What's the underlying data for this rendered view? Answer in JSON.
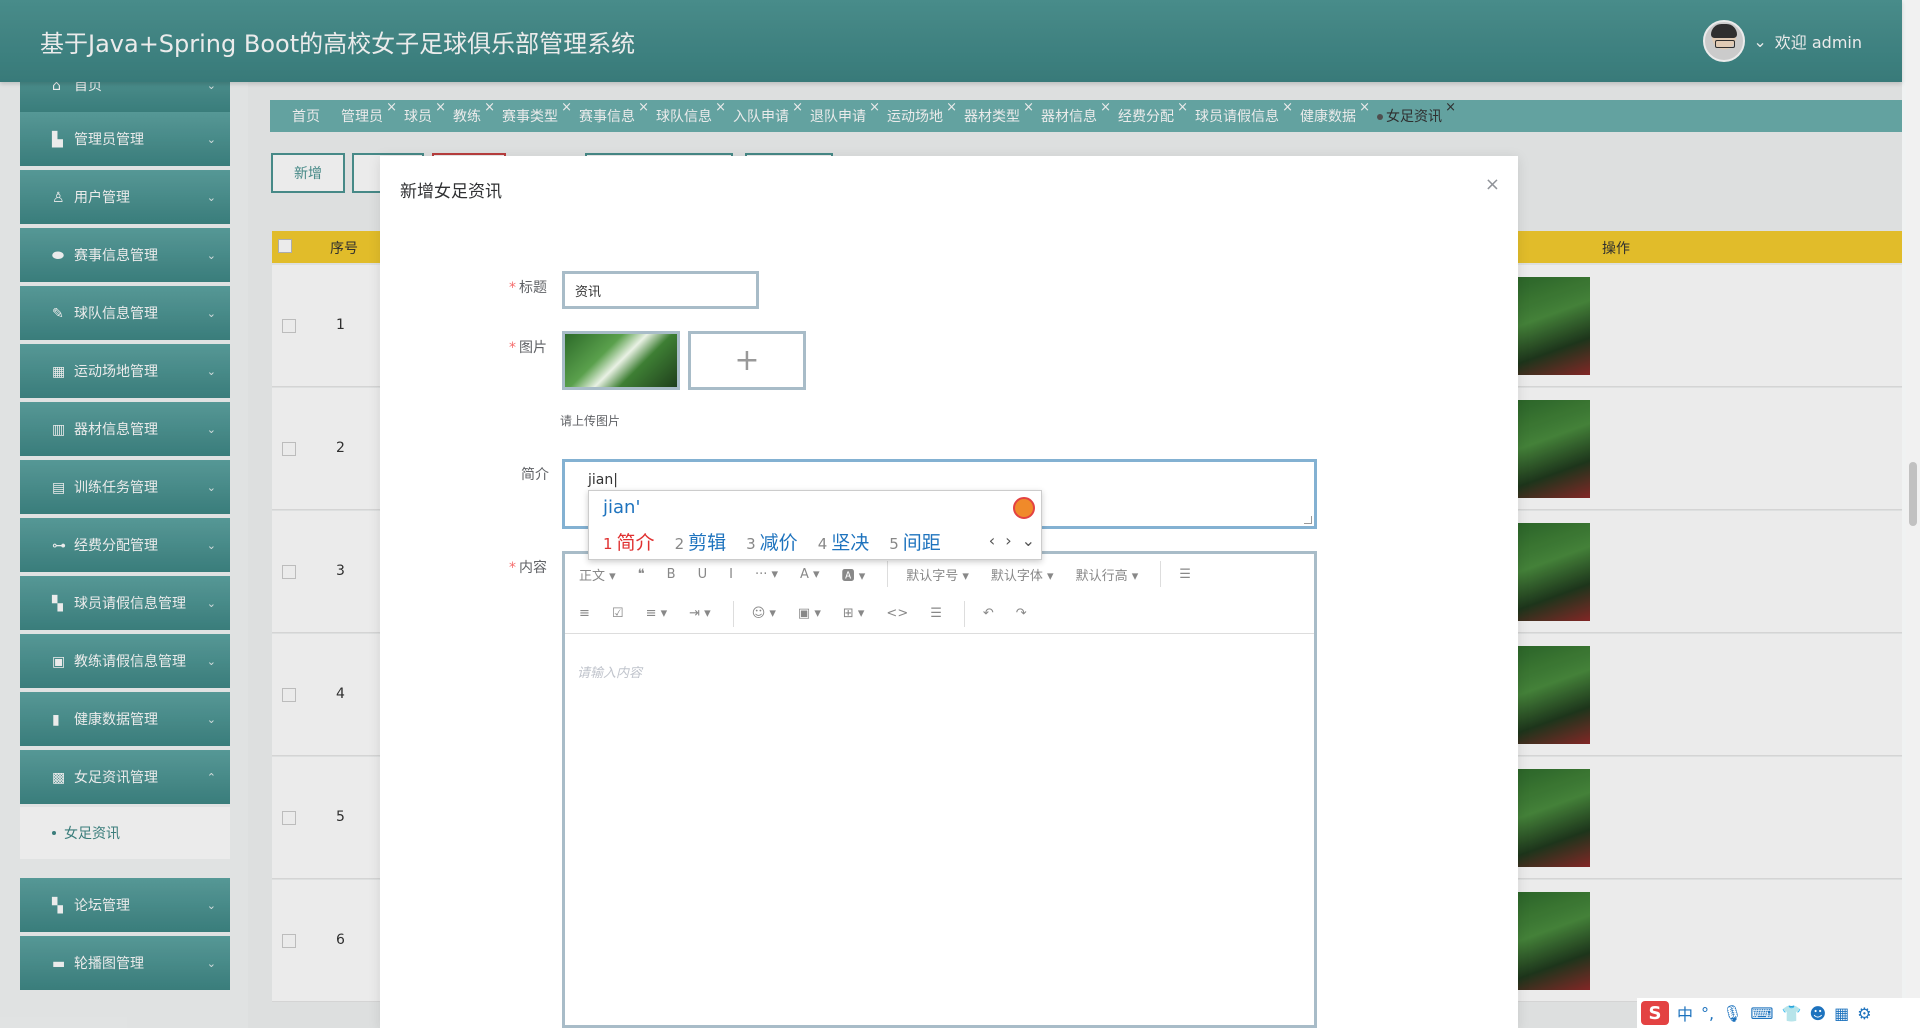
{
  "header": {
    "title": "基于Java+Spring Boot的高校女子足球俱乐部管理系统",
    "welcome": "欢迎 admin",
    "chevron": "⌄"
  },
  "sidebar": {
    "items": [
      {
        "label": "首页",
        "icon": "home-icon"
      },
      {
        "label": "管理员管理",
        "icon": "chart-icon"
      },
      {
        "label": "用户管理",
        "icon": "user-icon"
      },
      {
        "label": "赛事信息管理",
        "icon": "ellipsis-icon"
      },
      {
        "label": "球队信息管理",
        "icon": "edit-icon"
      },
      {
        "label": "运动场地管理",
        "icon": "grid-icon"
      },
      {
        "label": "器材信息管理",
        "icon": "equipment-icon"
      },
      {
        "label": "训练任务管理",
        "icon": "layout-icon"
      },
      {
        "label": "经费分配管理",
        "icon": "toggle-icon"
      },
      {
        "label": "球员请假信息管理",
        "icon": "apps-icon"
      },
      {
        "label": "教练请假信息管理",
        "icon": "badge-icon"
      },
      {
        "label": "健康数据管理",
        "icon": "mouse-icon"
      },
      {
        "label": "女足资讯管理",
        "icon": "news-icon"
      },
      {
        "label": "论坛管理",
        "icon": "apps-icon"
      },
      {
        "label": "轮播图管理",
        "icon": "image-icon"
      }
    ],
    "submenu_label": "女足资讯"
  },
  "tabs": [
    {
      "label": "首页",
      "closable": false
    },
    {
      "label": "管理员",
      "closable": true
    },
    {
      "label": "球员",
      "closable": true
    },
    {
      "label": "教练",
      "closable": true
    },
    {
      "label": "赛事类型",
      "closable": true
    },
    {
      "label": "赛事信息",
      "closable": true
    },
    {
      "label": "球队信息",
      "closable": true
    },
    {
      "label": "入队申请",
      "closable": true
    },
    {
      "label": "退队申请",
      "closable": true
    },
    {
      "label": "运动场地",
      "closable": true
    },
    {
      "label": "器材类型",
      "closable": true
    },
    {
      "label": "器材信息",
      "closable": true
    },
    {
      "label": "经费分配",
      "closable": true
    },
    {
      "label": "球员请假信息",
      "closable": true
    },
    {
      "label": "健康数据",
      "closable": true
    },
    {
      "label": "女足资讯",
      "closable": true,
      "active": true
    }
  ],
  "toolbar": {
    "add_label": "新增"
  },
  "table": {
    "headers": {
      "index": "序号",
      "action": "操作"
    },
    "rows": [
      "1",
      "2",
      "3",
      "4",
      "5",
      "6"
    ]
  },
  "dialog": {
    "title": "新增女足资讯",
    "close": "×",
    "fields": {
      "title_label": "标题",
      "title_value": "资讯",
      "image_label": "图片",
      "image_hint": "请上传图片",
      "summary_label": "简介",
      "summary_value": "jian",
      "content_label": "内容",
      "content_placeholder": "请输入内容"
    },
    "editor": {
      "row1": [
        "正文 ▾",
        "❝",
        "B",
        "U",
        "I",
        "··· ▾",
        "A ▾",
        "🅰 ▾",
        "默认字号 ▾",
        "默认字体 ▾",
        "默认行高 ▾",
        "☰"
      ],
      "row2": [
        "≡",
        "☑",
        "≡ ▾",
        "⇥ ▾",
        "☺ ▾",
        "▣ ▾",
        "⊞ ▾",
        "<>",
        "☰",
        "↶",
        "↷"
      ]
    }
  },
  "ime": {
    "pinyin": "jian'",
    "candidates": [
      {
        "n": "1",
        "text": "简介"
      },
      {
        "n": "2",
        "text": "剪辑"
      },
      {
        "n": "3",
        "text": "减价"
      },
      {
        "n": "4",
        "text": "坚决"
      },
      {
        "n": "5",
        "text": "间距"
      }
    ],
    "nav": [
      "‹",
      "›",
      "⌄"
    ],
    "bar": {
      "logo": "S",
      "mode": "中"
    }
  },
  "colors": {
    "header": "#4f9896",
    "sidebar_item": "#4f9896",
    "tabs": "#6cb0ae",
    "table_head": "#f5cd2e"
  }
}
